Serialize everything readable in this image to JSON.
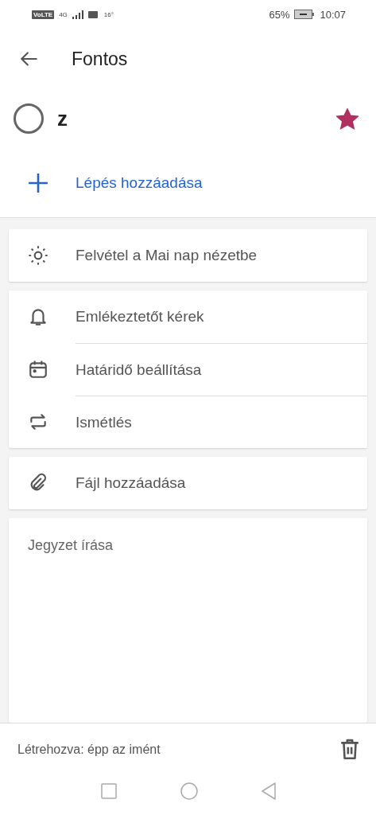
{
  "status_bar": {
    "network_badge": "VoLTE",
    "network_type": "4G",
    "temperature": "16°",
    "battery": "65%",
    "time": "10:07"
  },
  "header": {
    "title": "Fontos"
  },
  "task": {
    "title": "z",
    "completed": false,
    "important": true
  },
  "add_step": {
    "label": "Lépés hozzáadása"
  },
  "cards": [
    {
      "items": [
        {
          "kind": "sun",
          "label": "Felvétel a Mai nap nézetbe"
        }
      ]
    },
    {
      "items": [
        {
          "kind": "bell",
          "label": "Emlékeztetőt kérek"
        },
        {
          "kind": "calendar",
          "label": "Határidő beállítása"
        },
        {
          "kind": "repeat",
          "label": "Ismétlés"
        }
      ]
    },
    {
      "items": [
        {
          "kind": "clip",
          "label": "Fájl hozzáadása"
        }
      ]
    }
  ],
  "note": {
    "placeholder": "Jegyzet írása"
  },
  "footer": {
    "created": "Létrehozva: épp az imént"
  }
}
